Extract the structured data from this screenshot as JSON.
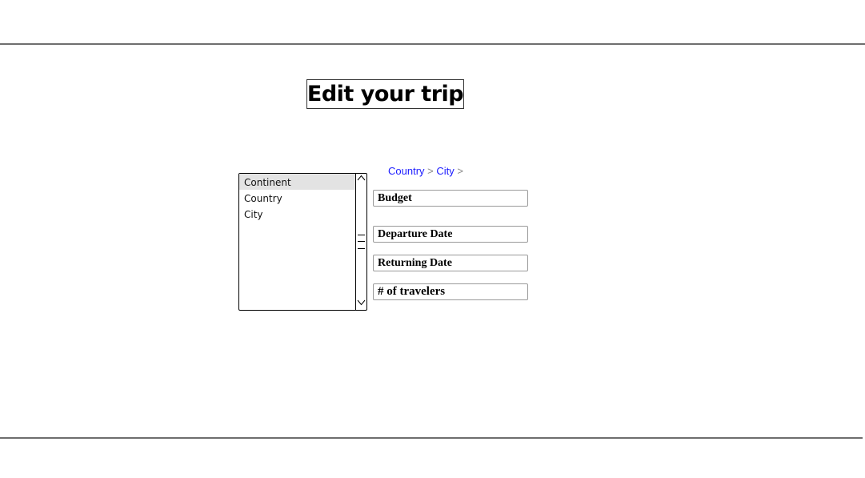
{
  "page": {
    "title": "Edit your trip"
  },
  "location_list": {
    "items": [
      {
        "label": "Continent",
        "selected": true
      },
      {
        "label": "Country",
        "selected": false
      },
      {
        "label": "City",
        "selected": false
      }
    ],
    "scroll_up_icon": "chevron-up-icon",
    "scroll_down_icon": "chevron-down-icon"
  },
  "breadcrumb": {
    "items": [
      "Country",
      "City"
    ],
    "separator": ">"
  },
  "form": {
    "budget_placeholder": "Budget",
    "departure_placeholder": "Departure Date",
    "returning_placeholder": "Returning Date",
    "travelers_placeholder": "# of travelers"
  },
  "colors": {
    "link": "#1a1aff",
    "separator": "#888888",
    "selected_row": "#e3e3e3",
    "rule": "#6e6e6e"
  }
}
